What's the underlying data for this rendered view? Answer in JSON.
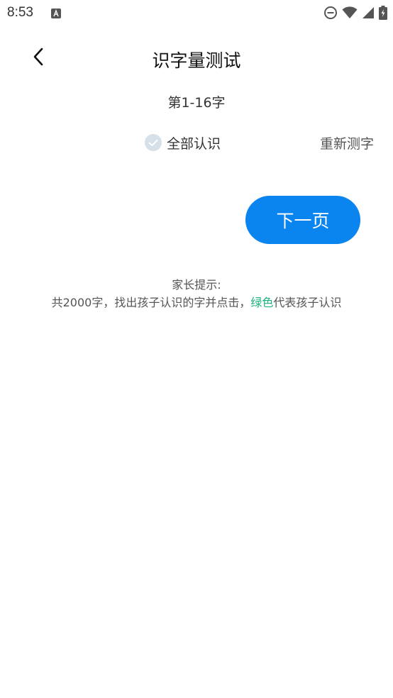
{
  "status_bar": {
    "time": "8:53"
  },
  "header": {
    "title": "识字量测试"
  },
  "range_label": "第1-16字",
  "options": {
    "all_known_label": "全部认识",
    "retest_label": "重新测字"
  },
  "next_button_label": "下一页",
  "tip": {
    "title": "家长提示:",
    "prefix": "共2000字，找出孩子认识的字并点击，",
    "highlight": "绿色",
    "suffix": "代表孩子认识"
  },
  "colors": {
    "primary_button": "#0a84ef",
    "highlight_green": "#1db37c",
    "check_circle": "#d5e0e8"
  }
}
